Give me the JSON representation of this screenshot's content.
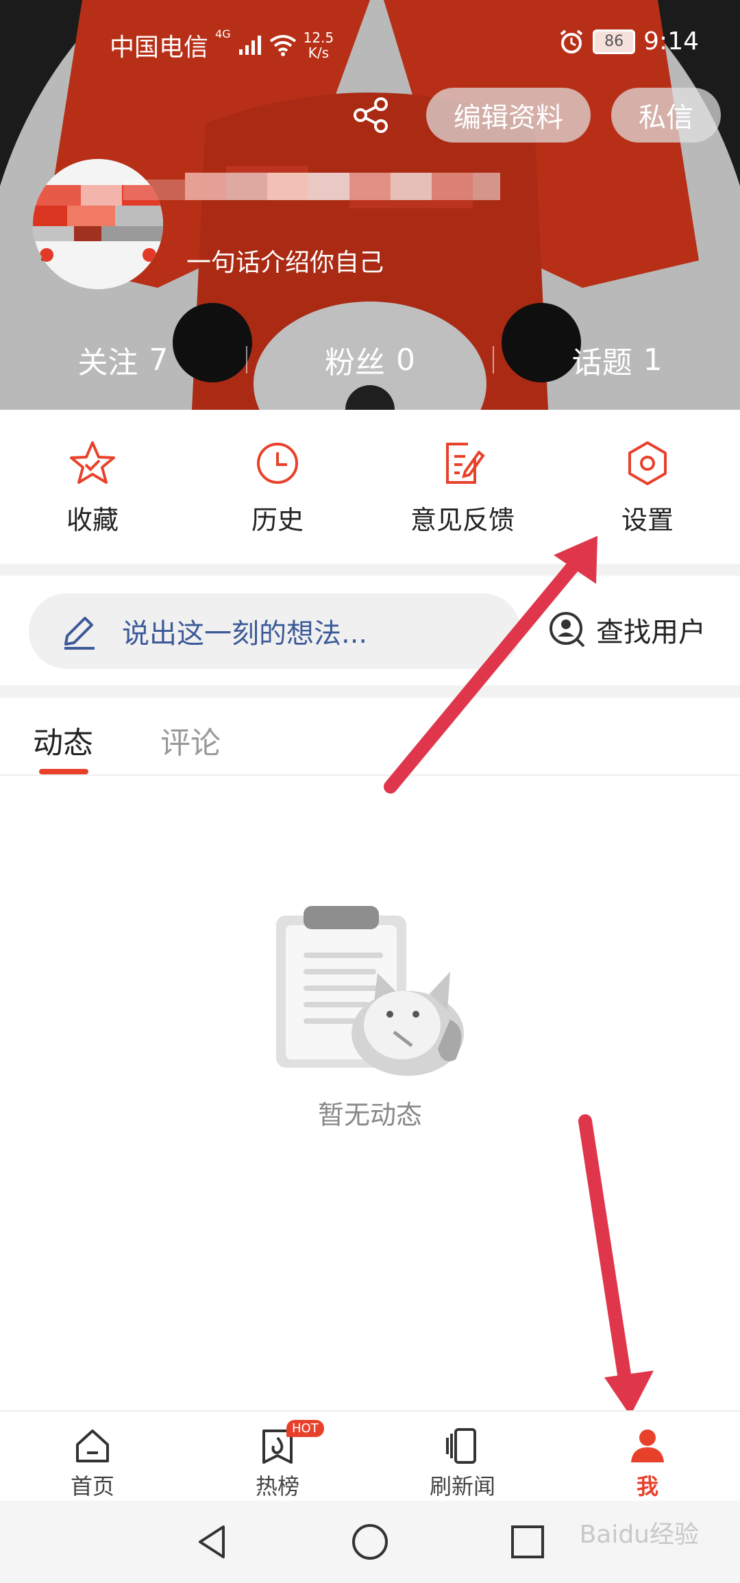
{
  "status_bar": {
    "carrier": "中国电信",
    "network": "4G",
    "speed_value": "12.5",
    "speed_unit": "K/s",
    "battery": "86",
    "time": "9:14"
  },
  "header": {
    "edit_profile_label": "编辑资料",
    "message_label": "私信",
    "bio": "一句话介绍你自己",
    "stats": [
      {
        "label": "关注",
        "value": "7"
      },
      {
        "label": "粉丝",
        "value": "0"
      },
      {
        "label": "话题",
        "value": "1"
      }
    ]
  },
  "quick_actions": [
    {
      "label": "收藏",
      "icon": "star-icon"
    },
    {
      "label": "历史",
      "icon": "clock-icon"
    },
    {
      "label": "意见反馈",
      "icon": "feedback-icon"
    },
    {
      "label": "设置",
      "icon": "settings-icon"
    }
  ],
  "post": {
    "placeholder": "说出这一刻的想法...",
    "find_user_label": "查找用户"
  },
  "tabs": [
    {
      "label": "动态",
      "active": true
    },
    {
      "label": "评论",
      "active": false
    }
  ],
  "empty_state": {
    "text": "暂无动态"
  },
  "bottom_nav": [
    {
      "label": "首页",
      "icon": "home-icon"
    },
    {
      "label": "热榜",
      "icon": "hot-list-icon",
      "badge": "HOT"
    },
    {
      "label": "刷新闻",
      "icon": "news-icon"
    },
    {
      "label": "我",
      "icon": "person-icon",
      "active": true
    }
  ],
  "watermark": "Baidu经验",
  "colors": {
    "accent": "#e8412b",
    "link": "#3c5a99",
    "fox_red": "#d9391c"
  }
}
